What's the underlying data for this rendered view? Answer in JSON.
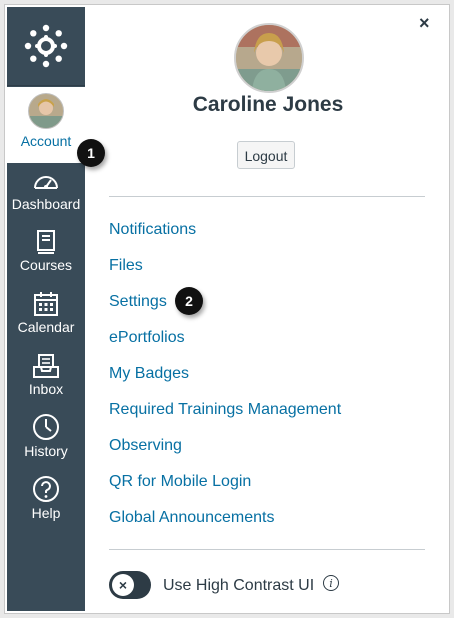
{
  "sidebar": {
    "account_label": "Account",
    "items": [
      {
        "label": "Dashboard",
        "icon": "dashboard-icon"
      },
      {
        "label": "Courses",
        "icon": "courses-icon"
      },
      {
        "label": "Calendar",
        "icon": "calendar-icon"
      },
      {
        "label": "Inbox",
        "icon": "inbox-icon"
      },
      {
        "label": "History",
        "icon": "history-icon"
      },
      {
        "label": "Help",
        "icon": "help-icon"
      }
    ]
  },
  "tray": {
    "close_glyph": "×",
    "user_name": "Caroline Jones",
    "logout_label": "Logout",
    "links": [
      "Notifications",
      "Files",
      "Settings",
      "ePortfolios",
      "My Badges",
      "Required Trainings Management",
      "Observing",
      "QR for Mobile Login",
      "Global Announcements"
    ],
    "high_contrast_label": "Use High Contrast UI",
    "toggle_glyph": "×",
    "info_glyph": "i"
  },
  "callouts": [
    "1",
    "2"
  ],
  "colors": {
    "sidebar": "#394b58",
    "link": "#0770a3",
    "text": "#2d3b45"
  }
}
